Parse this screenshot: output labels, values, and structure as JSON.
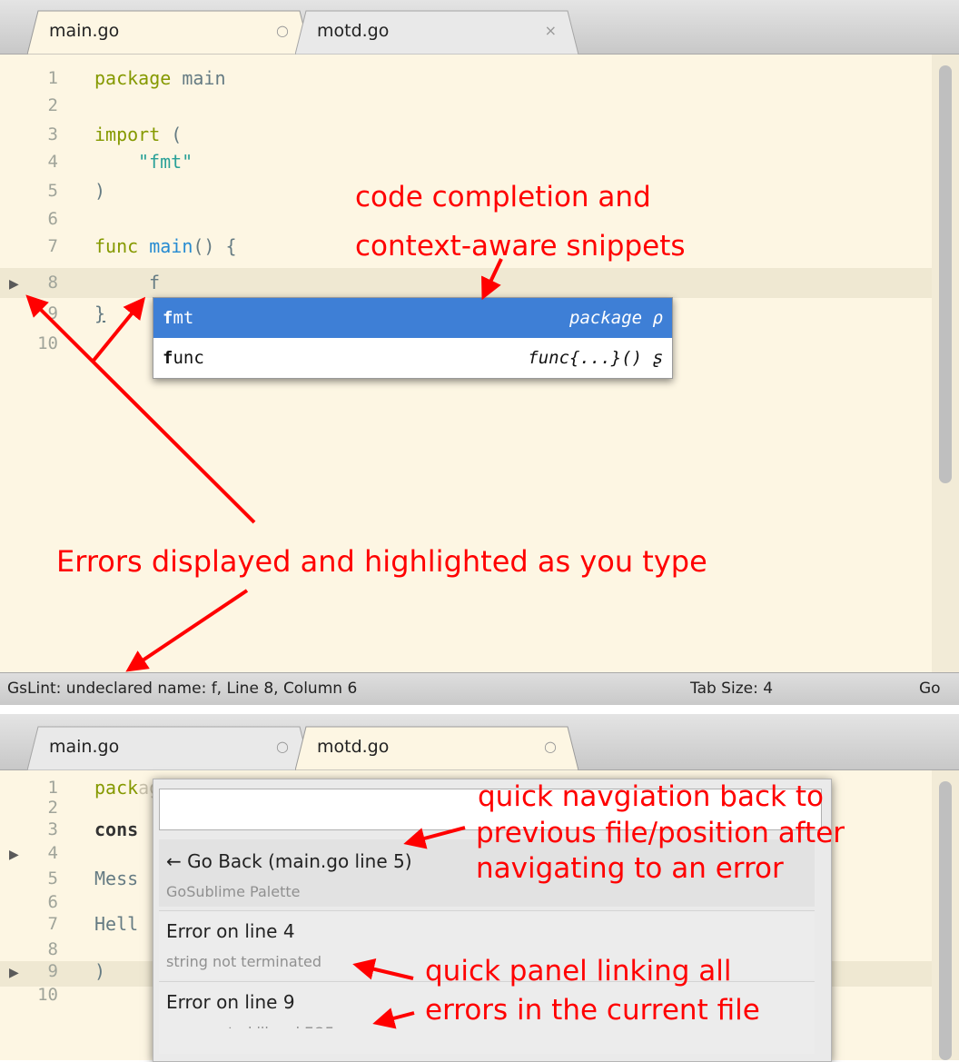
{
  "top_panel": {
    "tabs": [
      {
        "label": "main.go",
        "icon": "circle-icon",
        "active": true
      },
      {
        "label": "motd.go",
        "icon": "close-icon",
        "active": false
      }
    ],
    "line_numbers": [
      "1",
      "2",
      "3",
      "4",
      "5",
      "6",
      "7",
      "8",
      "9",
      "10"
    ],
    "code": {
      "l1_kw": "package",
      "l1_rest": " main",
      "l3_kw": "import",
      "l3_rest": " (",
      "l4_str": "\"fmt\"",
      "l5": ")",
      "l7_kw": "func",
      "l7_fn": "main",
      "l7_rest": "() {",
      "l8": "f",
      "l9": "}"
    },
    "autocomplete": [
      {
        "match": "f",
        "rest": "mt",
        "hint": "package ρ"
      },
      {
        "match": "f",
        "rest": "unc",
        "hint": "func{...}() ʂ"
      }
    ],
    "status": {
      "message": "GsLint: undeclared name: f, Line 8, Column 6",
      "tab_size": "Tab Size: 4",
      "syntax": "Go"
    },
    "annotations": {
      "completion_line1": "code completion and",
      "completion_line2": "context-aware snippets",
      "errors": "Errors displayed and highlighted as you type"
    }
  },
  "bottom_panel": {
    "tabs": [
      {
        "label": "main.go",
        "icon": "circle-icon",
        "active": false
      },
      {
        "label": "motd.go",
        "icon": "circle-icon",
        "active": true
      }
    ],
    "line_numbers": [
      "1",
      "2",
      "3",
      "4",
      "5",
      "6",
      "7",
      "8",
      "9",
      "10"
    ],
    "code": {
      "l1_kw": "pack",
      "l1_ghost": "age main",
      "l3": "cons",
      "l5": "Mess",
      "l7": "Hell",
      "l9": ")"
    },
    "palette": {
      "input_value": "",
      "items": [
        {
          "title": "← Go Back (main.go line 5)",
          "subtitle": "GoSublime Palette"
        },
        {
          "title": "Error on line 4",
          "subtitle": "string not terminated"
        },
        {
          "title": "Error on line 9",
          "subtitle": "unexpected illegal EOF"
        }
      ]
    },
    "annotations": {
      "nav_line1": "quick navgiation back to",
      "nav_line2": "previous file/position after",
      "nav_line3": "navigating to an error",
      "panel_line1": "quick panel linking all",
      "panel_line2": "errors in the current file"
    }
  },
  "colors": {
    "editor_bg": "#fdf6e3",
    "selection": "#3e7fd6",
    "annotation": "#ff0000",
    "keyword": "#859900",
    "string": "#2aa198",
    "function": "#268bd2"
  }
}
